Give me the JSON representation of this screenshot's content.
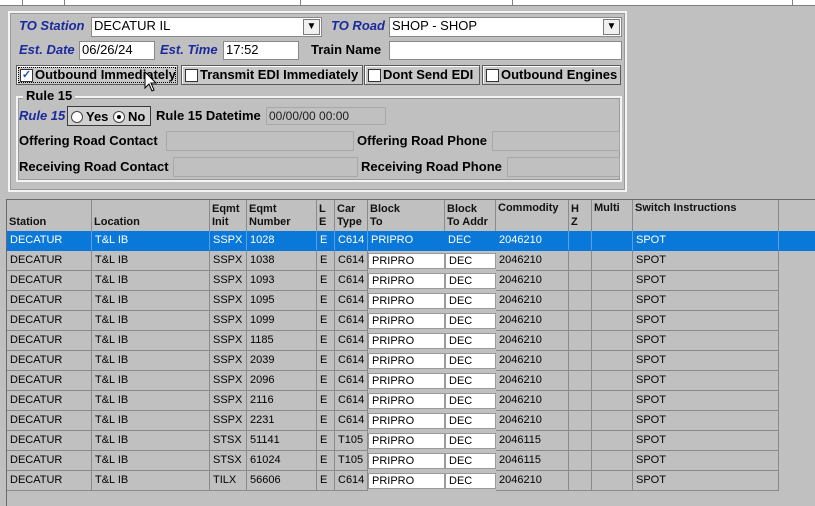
{
  "form": {
    "to_station_label": "TO Station",
    "to_station_value": "DECATUR IL",
    "to_road_label": "TO Road",
    "to_road_value": "SHOP - SHOP",
    "est_date_label": "Est. Date",
    "est_date_value": "06/26/24",
    "est_time_label": "Est. Time",
    "est_time_value": "17:52",
    "train_name_label": "Train Name",
    "train_name_value": ""
  },
  "options": [
    {
      "label": "Outbound Immediately",
      "checked": true
    },
    {
      "label": "Transmit EDI Immediately",
      "checked": false
    },
    {
      "label": "Dont Send EDI",
      "checked": false
    },
    {
      "label": "Outbound Engines",
      "checked": false
    }
  ],
  "rule15": {
    "group_title": "Rule 15",
    "label": "Rule 15",
    "yes_label": "Yes",
    "no_label": "No",
    "selected": "No",
    "datetime_label": "Rule 15 Datetime",
    "datetime_value": "00/00/00 00:00",
    "offering_contact_label": "Offering Road Contact",
    "offering_phone_label": "Offering Road Phone",
    "receiving_contact_label": "Receiving Road Contact",
    "receiving_phone_label": "Receiving Road Phone"
  },
  "grid": {
    "headers": [
      "Station",
      "Location",
      "Eqmt\nInit",
      "Eqmt\nNumber",
      "L\nE",
      "Car\nType",
      "Block\nTo",
      "Block\nTo Addr",
      "Commodity",
      "H\nZ",
      "Multi",
      "Switch Instructions"
    ],
    "selected_index": 0,
    "rows": [
      [
        "DECATUR",
        "T&L IB",
        "SSPX",
        "1028",
        "E",
        "C614",
        "PRIPRO",
        "DEC",
        "2046210",
        "",
        "",
        "SPOT"
      ],
      [
        "DECATUR",
        "T&L IB",
        "SSPX",
        "1038",
        "E",
        "C614",
        "PRIPRO",
        "DEC",
        "2046210",
        "",
        "",
        "SPOT"
      ],
      [
        "DECATUR",
        "T&L IB",
        "SSPX",
        "1093",
        "E",
        "C614",
        "PRIPRO",
        "DEC",
        "2046210",
        "",
        "",
        "SPOT"
      ],
      [
        "DECATUR",
        "T&L IB",
        "SSPX",
        "1095",
        "E",
        "C614",
        "PRIPRO",
        "DEC",
        "2046210",
        "",
        "",
        "SPOT"
      ],
      [
        "DECATUR",
        "T&L IB",
        "SSPX",
        "1099",
        "E",
        "C614",
        "PRIPRO",
        "DEC",
        "2046210",
        "",
        "",
        "SPOT"
      ],
      [
        "DECATUR",
        "T&L IB",
        "SSPX",
        "1185",
        "E",
        "C614",
        "PRIPRO",
        "DEC",
        "2046210",
        "",
        "",
        "SPOT"
      ],
      [
        "DECATUR",
        "T&L IB",
        "SSPX",
        "2039",
        "E",
        "C614",
        "PRIPRO",
        "DEC",
        "2046210",
        "",
        "",
        "SPOT"
      ],
      [
        "DECATUR",
        "T&L IB",
        "SSPX",
        "2096",
        "E",
        "C614",
        "PRIPRO",
        "DEC",
        "2046210",
        "",
        "",
        "SPOT"
      ],
      [
        "DECATUR",
        "T&L IB",
        "SSPX",
        "2116",
        "E",
        "C614",
        "PRIPRO",
        "DEC",
        "2046210",
        "",
        "",
        "SPOT"
      ],
      [
        "DECATUR",
        "T&L IB",
        "SSPX",
        "2231",
        "E",
        "C614",
        "PRIPRO",
        "DEC",
        "2046210",
        "",
        "",
        "SPOT"
      ],
      [
        "DECATUR",
        "T&L IB",
        "STSX",
        "51141",
        "E",
        "T105",
        "PRIPRO",
        "DEC",
        "2046115",
        "",
        "",
        "SPOT"
      ],
      [
        "DECATUR",
        "T&L IB",
        "STSX",
        "61024",
        "E",
        "T105",
        "PRIPRO",
        "DEC",
        "2046115",
        "",
        "",
        "SPOT"
      ],
      [
        "DECATUR",
        "T&L IB",
        "TILX",
        "56606",
        "E",
        "C614",
        "PRIPRO",
        "DEC",
        "2046210",
        "",
        "",
        "SPOT"
      ]
    ]
  },
  "colors": {
    "selection": "#0a78d8",
    "label_blue": "#1a2a9c",
    "background": "#c0c0c0"
  }
}
